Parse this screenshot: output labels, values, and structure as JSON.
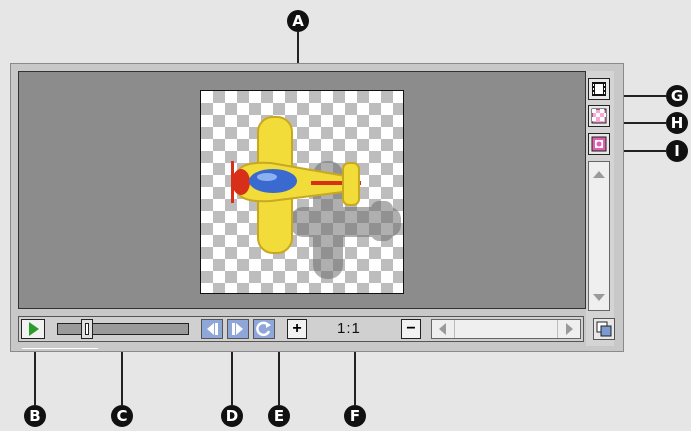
{
  "callouts": {
    "a": "A",
    "b": "B",
    "c": "C",
    "d": "D",
    "e": "E",
    "f": "F",
    "g": "G",
    "h": "H",
    "i": "I"
  },
  "controls": {
    "zoom_in_glyph": "+",
    "zoom_level": "1:1",
    "zoom_out_glyph": "−"
  },
  "colors": {
    "accent_green": "#2c9c2c",
    "accent_blue": "#3a6ad0",
    "plane_yellow": "#f2dc3a",
    "plane_red": "#d83018"
  },
  "icons": {
    "play": "play-icon",
    "step_back": "step-backward-icon",
    "step_forward": "step-forward-icon",
    "loop": "loop-icon",
    "film": "filmstrip-icon",
    "checker": "transparency-icon",
    "onion": "onion-skin-icon",
    "resize": "resize-grip-icon"
  }
}
